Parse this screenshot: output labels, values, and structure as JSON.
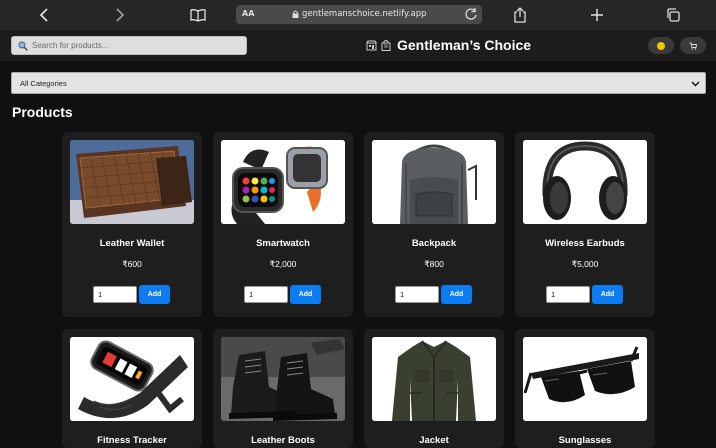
{
  "browser": {
    "reader_label": "AA",
    "url": "gentlemanschoice.netlify.app"
  },
  "header": {
    "search_placeholder": "Search for products...",
    "title": "Gentleman’s Choice",
    "cart_label": " "
  },
  "filter": {
    "category_selected": "All Categories"
  },
  "products_heading": "Products",
  "products": [
    {
      "name": "Leather Wallet",
      "price": "₹600",
      "qty": "1",
      "add_label": "Add",
      "icon": "wallet-photo"
    },
    {
      "name": "Smartwatch",
      "price": "₹2,000",
      "qty": "1",
      "add_label": "Add",
      "icon": "smartwatch-photo"
    },
    {
      "name": "Backpack",
      "price": "₹800",
      "qty": "1",
      "add_label": "Add",
      "icon": "backpack-photo"
    },
    {
      "name": "Wireless Earbuds",
      "price": "₹5,000",
      "qty": "1",
      "add_label": "Add",
      "icon": "headphones-photo"
    },
    {
      "name": "Fitness Tracker",
      "icon": "fitness-tracker-photo"
    },
    {
      "name": "Leather Boots",
      "icon": "boots-photo"
    },
    {
      "name": "Jacket",
      "icon": "jacket-photo"
    },
    {
      "name": "Sunglasses",
      "icon": "sunglasses-photo"
    }
  ],
  "colors": {
    "page_bg": "#101010",
    "card_bg": "#1e1e1e",
    "accent": "#0d7cf2",
    "theme_dot": "#f5c400"
  }
}
